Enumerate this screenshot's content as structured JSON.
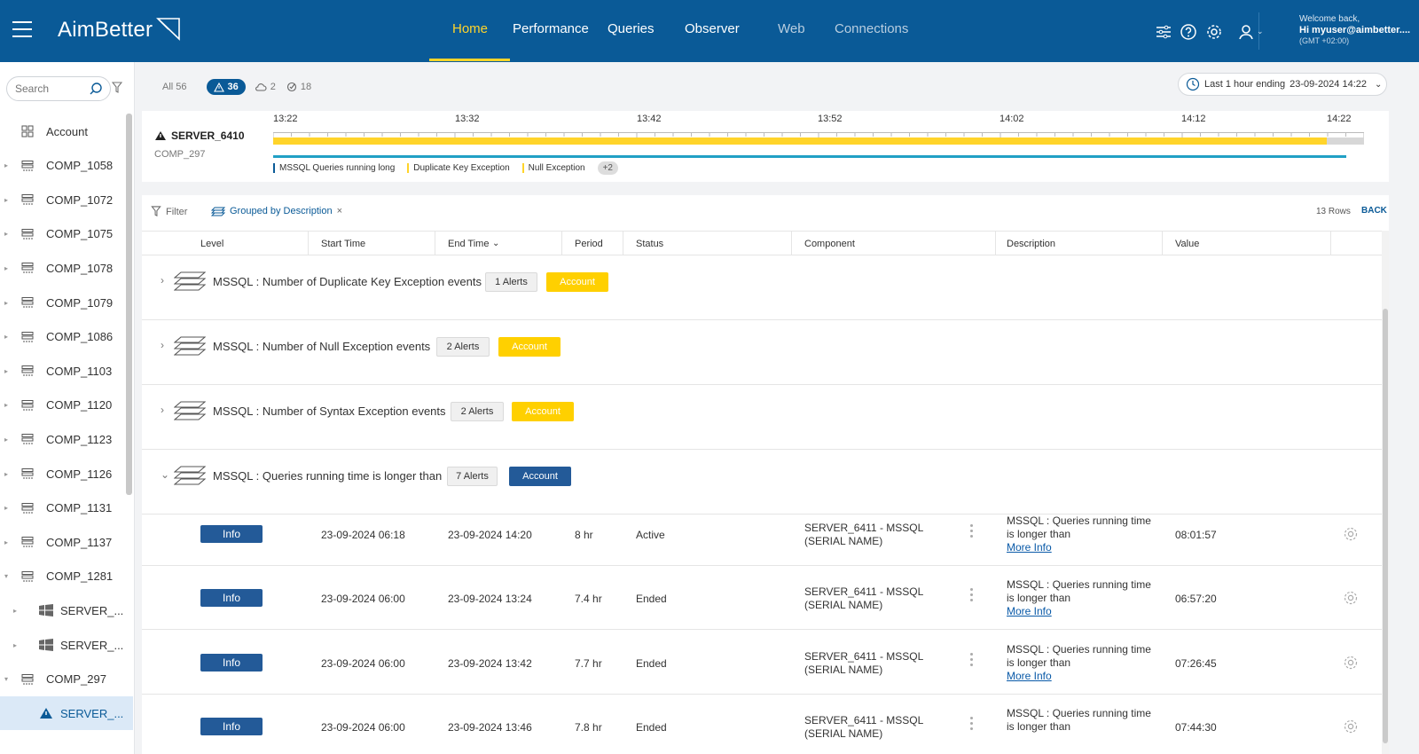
{
  "header": {
    "logo": "AimBetter",
    "nav": [
      {
        "label": "Home",
        "state": "active"
      },
      {
        "label": "Performance",
        "state": "normal"
      },
      {
        "label": "Queries",
        "state": "normal"
      },
      {
        "label": "Observer",
        "state": "normal"
      },
      {
        "label": "Web",
        "state": "dim"
      },
      {
        "label": "Connections",
        "state": "dim"
      }
    ],
    "welcome": "Welcome back,",
    "user": "Hi myuser@aimbetter....",
    "timezone": "(GMT +02:00)",
    "icons": [
      "sliders-icon",
      "help-icon",
      "gear-icon",
      "user-icon"
    ]
  },
  "sidebar": {
    "search_placeholder": "Search",
    "items": [
      {
        "label": "Account",
        "icon": "grid-icon",
        "caret": false,
        "sub": false
      },
      {
        "label": "COMP_1058",
        "icon": "server-icon",
        "caret": true,
        "sub": false
      },
      {
        "label": "COMP_1072",
        "icon": "server-icon",
        "caret": true,
        "sub": false
      },
      {
        "label": "COMP_1075",
        "icon": "server-icon",
        "caret": true,
        "sub": false
      },
      {
        "label": "COMP_1078",
        "icon": "server-icon",
        "caret": true,
        "sub": false
      },
      {
        "label": "COMP_1079",
        "icon": "server-icon",
        "caret": true,
        "sub": false
      },
      {
        "label": "COMP_1086",
        "icon": "server-icon",
        "caret": true,
        "sub": false
      },
      {
        "label": "COMP_1103",
        "icon": "server-icon",
        "caret": true,
        "sub": false
      },
      {
        "label": "COMP_1120",
        "icon": "server-icon",
        "caret": true,
        "sub": false
      },
      {
        "label": "COMP_1123",
        "icon": "server-icon",
        "caret": true,
        "sub": false
      },
      {
        "label": "COMP_1126",
        "icon": "server-icon",
        "caret": true,
        "sub": false
      },
      {
        "label": "COMP_1131",
        "icon": "server-icon",
        "caret": true,
        "sub": false
      },
      {
        "label": "COMP_1137",
        "icon": "server-icon",
        "caret": true,
        "sub": false
      },
      {
        "label": "COMP_1281",
        "icon": "server-icon",
        "caret": true,
        "sub": false
      },
      {
        "label": "SERVER_...",
        "icon": "windows-icon",
        "caret": true,
        "sub": true
      },
      {
        "label": "SERVER_...",
        "icon": "windows-icon",
        "caret": true,
        "sub": true
      },
      {
        "label": "COMP_297",
        "icon": "server-icon",
        "caret": true,
        "sub": false
      },
      {
        "label": "SERVER_...",
        "icon": "alert-icon",
        "caret": false,
        "sub": true,
        "selected": true
      }
    ]
  },
  "filters": {
    "all": "All 56",
    "alerts": "36",
    "cloud": "2",
    "resolved": "18",
    "timerange_label": "Last 1 hour ending",
    "timerange_value": "23-09-2024 14:22"
  },
  "timeline": {
    "server": "SERVER_6410",
    "comp": "COMP_297",
    "ticks": [
      "13:22",
      "13:32",
      "13:42",
      "13:52",
      "14:02",
      "14:12",
      "14:22"
    ],
    "legend": [
      "MSSQL Queries running long",
      "Duplicate Key Exception",
      "Null Exception"
    ],
    "more": "+2"
  },
  "table": {
    "filter_label": "Filter",
    "grouped_label": "Grouped by Description",
    "rows_count": "13 Rows",
    "back_label": "BACK",
    "columns": [
      "Level",
      "Start Time",
      "End Time",
      "Period",
      "Status",
      "Component",
      "Description",
      "Value"
    ],
    "groups": [
      {
        "title": "MSSQL : Number of Duplicate Key Exception events",
        "alerts": "1 Alerts",
        "badge": "Account",
        "badge_color": "yellow",
        "expanded": false
      },
      {
        "title": "MSSQL : Number of Null Exception events",
        "alerts": "2 Alerts",
        "badge": "Account",
        "badge_color": "yellow",
        "expanded": false
      },
      {
        "title": "MSSQL : Number of Syntax Exception events",
        "alerts": "2 Alerts",
        "badge": "Account",
        "badge_color": "yellow",
        "expanded": false
      },
      {
        "title": "MSSQL : Queries running time is longer than",
        "alerts": "7 Alerts",
        "badge": "Account",
        "badge_color": "blue",
        "expanded": true
      }
    ],
    "rows": [
      {
        "level": "Info",
        "start": "23-09-2024 06:18",
        "end": "23-09-2024 14:20",
        "period": "8 hr",
        "status": "Active",
        "component": "SERVER_6411 - MSSQL (SERIAL NAME)",
        "description": "MSSQL : Queries running time is longer than",
        "more": "More Info",
        "value": "08:01:57"
      },
      {
        "level": "Info",
        "start": "23-09-2024 06:00",
        "end": "23-09-2024 13:24",
        "period": "7.4 hr",
        "status": "Ended",
        "component": "SERVER_6411 - MSSQL (SERIAL NAME)",
        "description": "MSSQL : Queries running time is longer than",
        "more": "More Info",
        "value": "06:57:20"
      },
      {
        "level": "Info",
        "start": "23-09-2024 06:00",
        "end": "23-09-2024 13:42",
        "period": "7.7 hr",
        "status": "Ended",
        "component": "SERVER_6411 - MSSQL (SERIAL NAME)",
        "description": "MSSQL : Queries running time is longer than",
        "more": "More Info",
        "value": "07:26:45"
      },
      {
        "level": "Info",
        "start": "23-09-2024 06:00",
        "end": "23-09-2024 13:46",
        "period": "7.8 hr",
        "status": "Ended",
        "component": "SERVER_6411 - MSSQL (SERIAL NAME)",
        "description": "MSSQL : Queries running time is longer than",
        "more": "",
        "value": "07:44:30"
      }
    ]
  },
  "colors": {
    "brand": "#0a5a97",
    "accent": "#ffd42a",
    "badge_blue": "#235a98",
    "badge_yellow": "#ffd000",
    "timeline_blue": "#21a0c5"
  }
}
